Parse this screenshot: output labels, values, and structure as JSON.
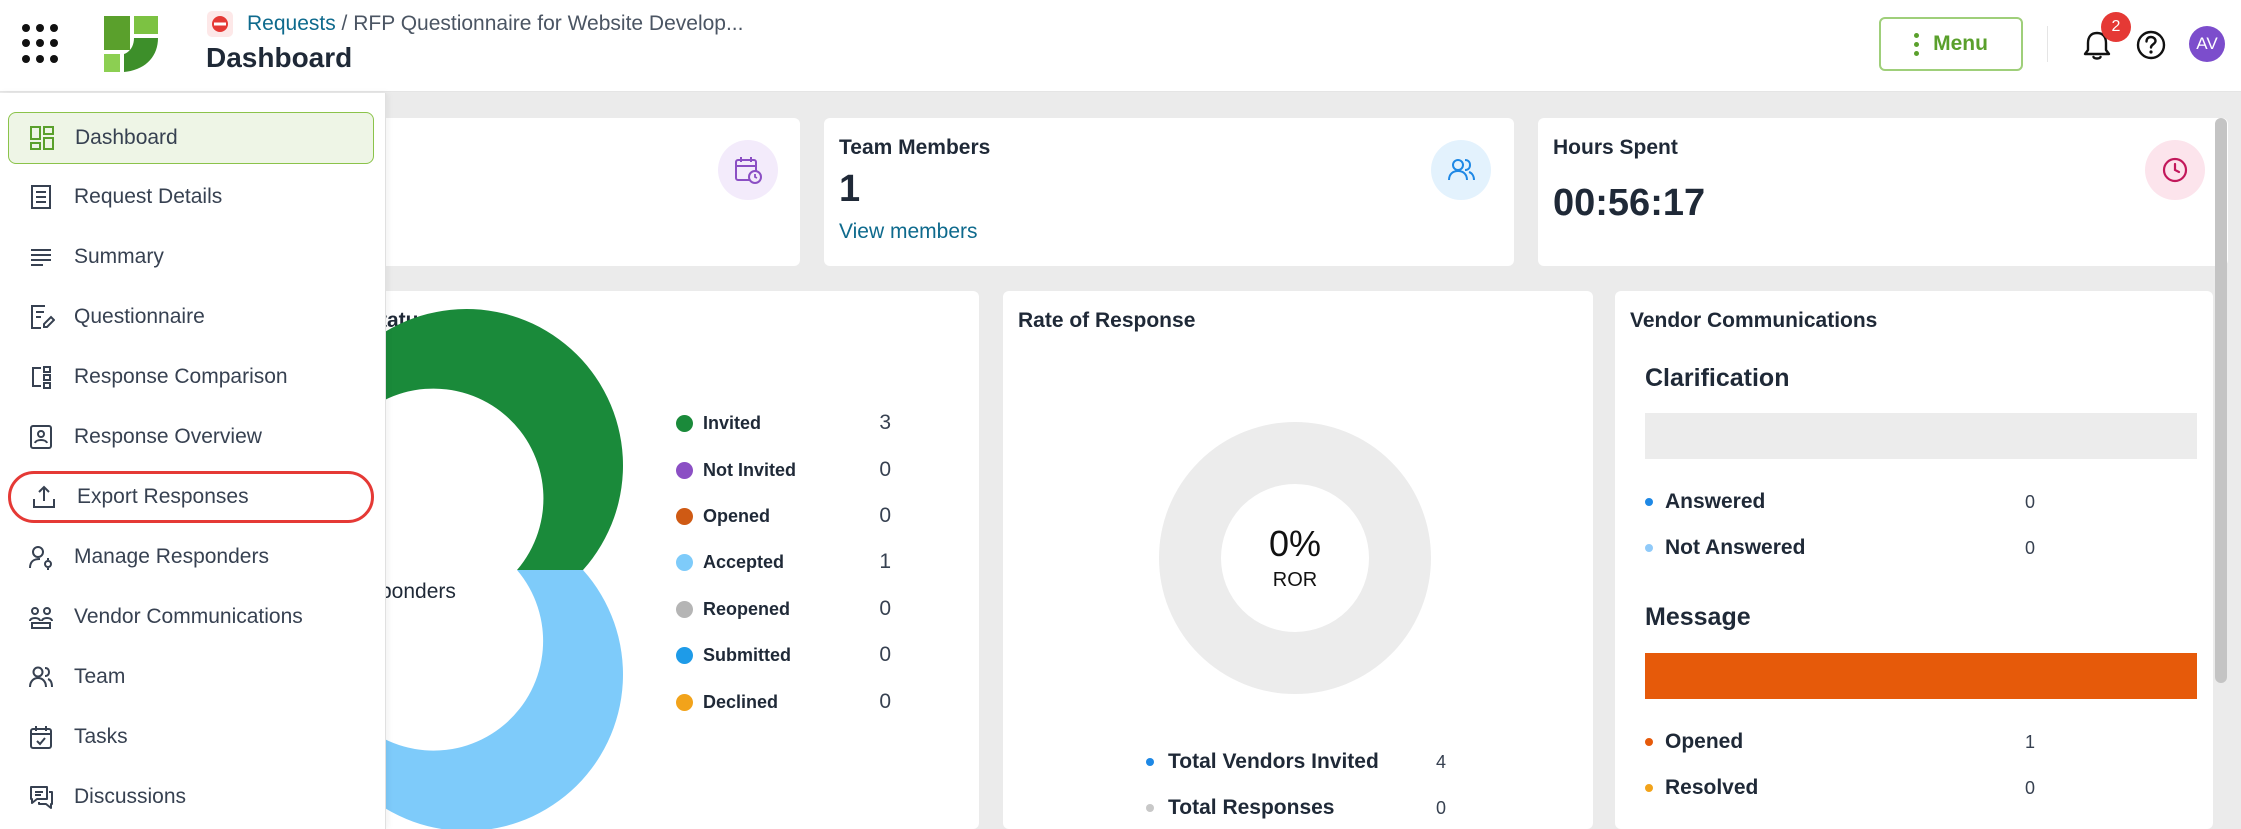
{
  "header": {
    "breadcrumb_link": "Requests",
    "breadcrumb_sep": " / ",
    "breadcrumb_current": "RFP Questionnaire for Website Develop...",
    "title": "Dashboard",
    "menu_label": "Menu",
    "notification_count": "2",
    "avatar_initials": "AV"
  },
  "sidebar": {
    "items": [
      {
        "label": "Dashboard",
        "icon": "dashboard-grid-icon"
      },
      {
        "label": "Request Details",
        "icon": "document-list-icon"
      },
      {
        "label": "Summary",
        "icon": "lines-icon"
      },
      {
        "label": "Questionnaire",
        "icon": "edit-document-icon"
      },
      {
        "label": "Response Comparison",
        "icon": "compare-icon"
      },
      {
        "label": "Response Overview",
        "icon": "overview-icon"
      },
      {
        "label": "Export Responses",
        "icon": "export-icon"
      },
      {
        "label": "Manage Responders",
        "icon": "manage-user-icon"
      },
      {
        "label": "Vendor Communications",
        "icon": "vendor-group-icon"
      },
      {
        "label": "Team",
        "icon": "team-icon"
      },
      {
        "label": "Tasks",
        "icon": "calendar-check-icon"
      },
      {
        "label": "Discussions",
        "icon": "chat-icon"
      }
    ]
  },
  "stats": {
    "team_members_label": "Team Members",
    "team_members_value": "1",
    "view_members_link": "View members",
    "hours_label": "Hours Spent",
    "hours_value": "00:56:17"
  },
  "status_card": {
    "title_fragment": "tatus",
    "center_fragment": "ponders",
    "legend": [
      {
        "label": "Invited",
        "value": "3",
        "color": "#1a8a3a"
      },
      {
        "label": "Not Invited",
        "value": "0",
        "color": "#8b4fc4"
      },
      {
        "label": "Opened",
        "value": "0",
        "color": "#cf5a14"
      },
      {
        "label": "Accepted",
        "value": "1",
        "color": "#7ecbfa"
      },
      {
        "label": "Reopened",
        "value": "0",
        "color": "#b5b5b5"
      },
      {
        "label": "Submitted",
        "value": "0",
        "color": "#1e9be8"
      },
      {
        "label": "Declined",
        "value": "0",
        "color": "#f2a31a"
      }
    ]
  },
  "ror_card": {
    "title": "Rate of Response",
    "percent": "0%",
    "center_label": "ROR",
    "rows": [
      {
        "label": "Total Vendors Invited",
        "value": "4",
        "color": "#1e88e5"
      },
      {
        "label": "Total Responses",
        "value": "0",
        "color": "#c8c8c8"
      }
    ]
  },
  "vendor_card": {
    "title": "Vendor Communications",
    "clarification_title": "Clarification",
    "clarification_rows": [
      {
        "label": "Answered",
        "value": "0",
        "color": "#1e88e5"
      },
      {
        "label": "Not Answered",
        "value": "0",
        "color": "#90caf9"
      }
    ],
    "message_title": "Message",
    "message_bar_color": "#e65a0a",
    "message_rows": [
      {
        "label": "Opened",
        "value": "1",
        "color": "#e65a0a"
      },
      {
        "label": "Resolved",
        "value": "0",
        "color": "#f2a31a"
      }
    ]
  }
}
